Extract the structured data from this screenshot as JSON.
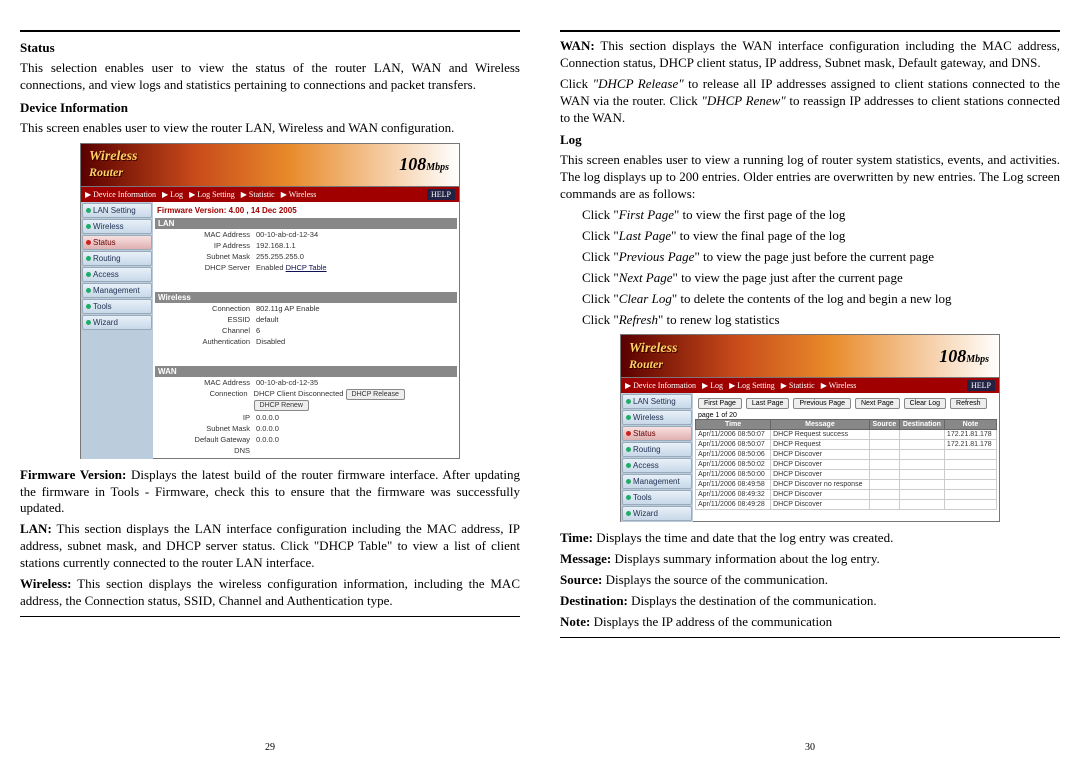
{
  "left": {
    "h_status": "Status",
    "p_status": "This selection enables user to view the status of the router LAN, WAN and Wireless connections, and view logs and statistics pertaining to connections and packet transfers.",
    "h_devinfo": "Device Information",
    "p_devinfo": "This screen enables user to view the router LAN, Wireless and WAN configuration.",
    "fw_label": "Firmware Version:",
    "fw_text": " Displays the latest build of the router firmware interface. After updating the firmware in Tools - Firmware, check this to ensure that the firmware was successfully updated.",
    "lan_label": "LAN:",
    "lan_text": " This section displays the LAN interface configuration including the MAC address, IP address, subnet mask, and DHCP server status. Click \"DHCP Table\" to view a list of client stations currently connected to the router LAN interface.",
    "wl_label": "Wireless:",
    "wl_text": " This section displays the wireless configuration information, including the MAC address, the Connection status, SSID, Channel and Authentication type.",
    "page_num": "29"
  },
  "right": {
    "wan_label": "WAN:",
    "wan_text": " This section displays the WAN interface configuration including the MAC address, Connection status, DHCP client status, IP address, Subnet mask, Default gateway, and DNS.",
    "dhcp_rel_pre": "Click ",
    "dhcp_rel_em": "\"DHCP Release\"",
    "dhcp_rel_post": " to release all IP addresses assigned to client stations connected to the WAN via the router. Click ",
    "dhcp_ren_em": "\"DHCP Renew\"",
    "dhcp_ren_post": " to reassign IP addresses to client stations connected to the WAN.",
    "h_log": "Log",
    "p_log": "This screen enables user to view a running log of router system statistics, events, and activities. The log displays up to 200 entries. Older entries are overwritten by new entries. The Log screen commands are as follows:",
    "li1_pre": "Click \"",
    "li1_em": "First Page",
    "li1_post": "\" to view the first page of the log",
    "li2_pre": "Click \"",
    "li2_em": "Last Page",
    "li2_post": "\" to view the final page of the log",
    "li3_pre": "Click \"",
    "li3_em": "Previous Page",
    "li3_post": "\" to view the page just before the current page",
    "li4_pre": "Click \"",
    "li4_em": "Next Page",
    "li4_post": "\" to view the page just after the current page",
    "li5_pre": "Click \"",
    "li5_em": "Clear Log",
    "li5_post": "\" to delete the contents of the log and begin a new log",
    "li6_pre": "Click \"",
    "li6_em": "Refresh",
    "li6_post": "\" to renew log statistics",
    "time_l": "Time:",
    "time_t": " Displays the time and date that the log entry was created.",
    "msg_l": "Message:",
    "msg_t": " Displays summary information about the log entry.",
    "src_l": "Source:",
    "src_t": " Displays the source of the communication.",
    "dst_l": "Destination:",
    "dst_t": " Displays the destination of the communication.",
    "note_l": "Note:",
    "note_t": " Displays the IP address of the communication",
    "page_num": "30"
  },
  "router": {
    "brand1": "Wireless",
    "brand2": "Router",
    "mbps": "108",
    "mbps_unit": "Mbps",
    "help": "HELP",
    "sidebar": [
      "LAN Setting",
      "Wireless",
      "Status",
      "Routing",
      "Access",
      "Management",
      "Tools",
      "Wizard"
    ],
    "crumbs1": [
      "▶ Device Information",
      "▶ Log",
      "▶ Log Setting",
      "▶ Statistic",
      "▶ Wireless"
    ],
    "firmware": "Firmware Version: 4.00 , 14 Dec 2005",
    "lan": {
      "title": "LAN",
      "rows": [
        {
          "k": "MAC Address",
          "v": "00-10-ab-cd-12-34"
        },
        {
          "k": "IP Address",
          "v": "192.168.1.1"
        },
        {
          "k": "Subnet Mask",
          "v": "255.255.255.0"
        },
        {
          "k": "DHCP Server",
          "v": "Enabled ",
          "link": "DHCP Table"
        }
      ]
    },
    "wireless": {
      "title": "Wireless",
      "rows": [
        {
          "k": "Connection",
          "v": "802.11g AP Enable"
        },
        {
          "k": "ESSID",
          "v": "default"
        },
        {
          "k": "Channel",
          "v": "6"
        },
        {
          "k": "Authentication",
          "v": "Disabled"
        }
      ]
    },
    "wan": {
      "title": "WAN",
      "rows": [
        {
          "k": "MAC Address",
          "v": "00-10-ab-cd-12-35"
        },
        {
          "k": "Connection",
          "v": "DHCP Client Disconnected",
          "btns": [
            "DHCP Release",
            "DHCP Renew"
          ]
        },
        {
          "k": "IP",
          "v": "0.0.0.0"
        },
        {
          "k": "Subnet Mask",
          "v": "0.0.0.0"
        },
        {
          "k": "Default Gateway",
          "v": "0.0.0.0"
        },
        {
          "k": "DNS",
          "v": ""
        }
      ]
    },
    "log": {
      "buttons": [
        "First Page",
        "Last Page",
        "Previous Page",
        "Next Page",
        "Clear Log",
        "Refresh"
      ],
      "page_info": "page 1 of 20",
      "headers": [
        "Time",
        "Message",
        "Source",
        "Destination",
        "Note"
      ],
      "rows": [
        [
          "Apr/11/2006 08:50:07",
          "DHCP Request success",
          "",
          "",
          "172.21.81.178"
        ],
        [
          "Apr/11/2006 08:50:07",
          "DHCP Request",
          "",
          "",
          "172.21.81.178"
        ],
        [
          "Apr/11/2006 08:50:06",
          "DHCP Discover",
          "",
          "",
          ""
        ],
        [
          "Apr/11/2006 08:50:02",
          "DHCP Discover",
          "",
          "",
          ""
        ],
        [
          "Apr/11/2006 08:50:00",
          "DHCP Discover",
          "",
          "",
          ""
        ],
        [
          "Apr/11/2006 08:49:58",
          "DHCP Discover no response",
          "",
          "",
          ""
        ],
        [
          "Apr/11/2006 08:49:32",
          "DHCP Discover",
          "",
          "",
          ""
        ],
        [
          "Apr/11/2006 08:49:28",
          "DHCP Discover",
          "",
          "",
          ""
        ]
      ]
    }
  }
}
